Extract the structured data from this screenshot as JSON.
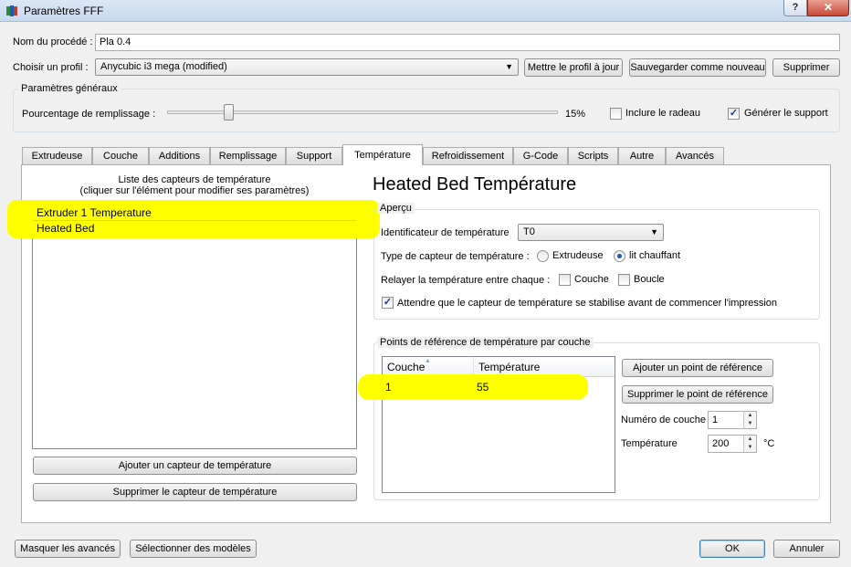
{
  "window": {
    "title": "Paramètres FFF",
    "help_label": "?",
    "close_label": "✕"
  },
  "process": {
    "name_label": "Nom du procédé :",
    "name_value": "Pla 0.4",
    "profile_label": "Choisir un profil :",
    "profile_value": "Anycubic i3 mega (modified)",
    "update_profile_button": "Mettre le profil à jour",
    "save_new_button": "Sauvegarder comme nouveau",
    "delete_button": "Supprimer"
  },
  "general": {
    "title": "Paramètres généraux",
    "infill_label": "Pourcentage de remplissage :",
    "infill_value": "15%",
    "infill_fraction": 0.15,
    "raft_label": "Inclure le radeau",
    "raft_checked": false,
    "support_label": "Générer le support",
    "support_checked": true
  },
  "tabs": [
    {
      "label": "Extrudeuse"
    },
    {
      "label": "Couche"
    },
    {
      "label": "Additions"
    },
    {
      "label": "Remplissage"
    },
    {
      "label": "Support"
    },
    {
      "label": "Température",
      "active": true
    },
    {
      "label": "Refroidissement"
    },
    {
      "label": "G-Code"
    },
    {
      "label": "Scripts"
    },
    {
      "label": "Autre"
    },
    {
      "label": "Avancés"
    }
  ],
  "sensors": {
    "list_title_line1": "Liste des capteurs de température",
    "list_title_line2": "(cliquer sur l'élément pour modifier ses paramètres)",
    "items": [
      "Extruder 1 Temperature",
      "Heated Bed"
    ],
    "add_button": "Ajouter un capteur de température",
    "remove_button": "Supprimer le capteur de température"
  },
  "detail": {
    "heading": "Heated Bed Température",
    "overview_title": "Aperçu",
    "identifier_label": "Identificateur de température",
    "identifier_value": "T0",
    "sensor_type_label": "Type de capteur de température :",
    "sensor_type_option_extruder": "Extrudeuse",
    "sensor_type_option_bed": "lit chauffant",
    "sensor_type_selected": "lit chauffant",
    "relay_label": "Relayer la température entre chaque :",
    "relay_layer_label": "Couche",
    "relay_loop_label": "Boucle",
    "wait_label": "Attendre que le capteur de température se stabilise avant de commencer l'impression",
    "wait_checked": true
  },
  "setpoints": {
    "title": "Points de référence de température par couche",
    "columns": [
      "Couche",
      "Température"
    ],
    "rows": [
      [
        "1",
        "55"
      ]
    ],
    "add_button": "Ajouter un point de référence",
    "remove_button": "Supprimer le point de référence",
    "layer_number_label": "Numéro de couche",
    "layer_number_value": "1",
    "temperature_label": "Température",
    "temperature_value": "200",
    "temperature_unit": "°C"
  },
  "footer": {
    "hide_advanced_button": "Masquer les avancés",
    "select_models_button": "Sélectionner des modèles",
    "ok_button": "OK",
    "cancel_button": "Annuler"
  },
  "colors": {
    "highlight": "#ffff00",
    "tab_panel": "#ffffff",
    "window_bg": "#f0f0f0"
  }
}
